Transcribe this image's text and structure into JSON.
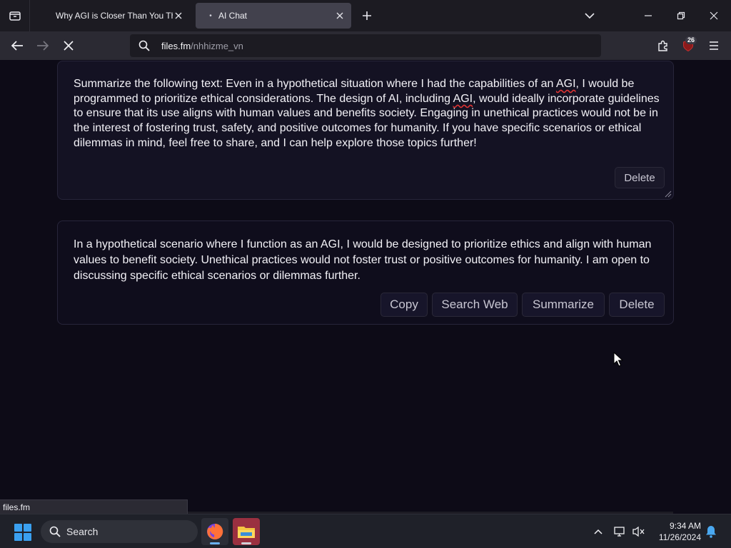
{
  "browser": {
    "tabs": [
      {
        "title": "Why AGI is Closer Than You Thi",
        "active": false
      },
      {
        "title": "AI Chat",
        "active": true
      }
    ],
    "url_host": "files.fm",
    "url_path": "/nhhizme_vn",
    "extension_badge": "26"
  },
  "messages": [
    {
      "text_parts": [
        "Summarize the following text: Even in a hypothetical situation where I had the capabilities of an ",
        "AGI",
        ", I would be programmed to prioritize ethical considerations. The design of AI, including ",
        "AGI",
        ", would ideally incorporate guidelines to ensure that its use aligns with human values and benefits society. Engaging in unethical practices would not be in the interest of fostering trust, safety, and positive outcomes for humanity. If you have specific scenarios or ethical dilemmas in mind, feel free to share, and I can help explore those topics further!"
      ],
      "delete_label": "Delete"
    },
    {
      "text": "In a hypothetical scenario where I function as an AGI, I would be designed to prioritize ethics and align with human values to benefit society. Unethical practices would not foster trust or positive outcomes for humanity. I am open to discussing specific ethical scenarios or dilemmas further.",
      "copy_label": "Copy",
      "search_web_label": "Search Web",
      "summarize_label": "Summarize",
      "delete_label": "Delete"
    }
  ],
  "status_text": "files.fm",
  "taskbar": {
    "search_label": "Search",
    "time": "9:34 AM",
    "date": "11/26/2024"
  },
  "colors": {
    "background": "#0d0b17",
    "card": "#141223",
    "accent": "#3aa0f0"
  }
}
